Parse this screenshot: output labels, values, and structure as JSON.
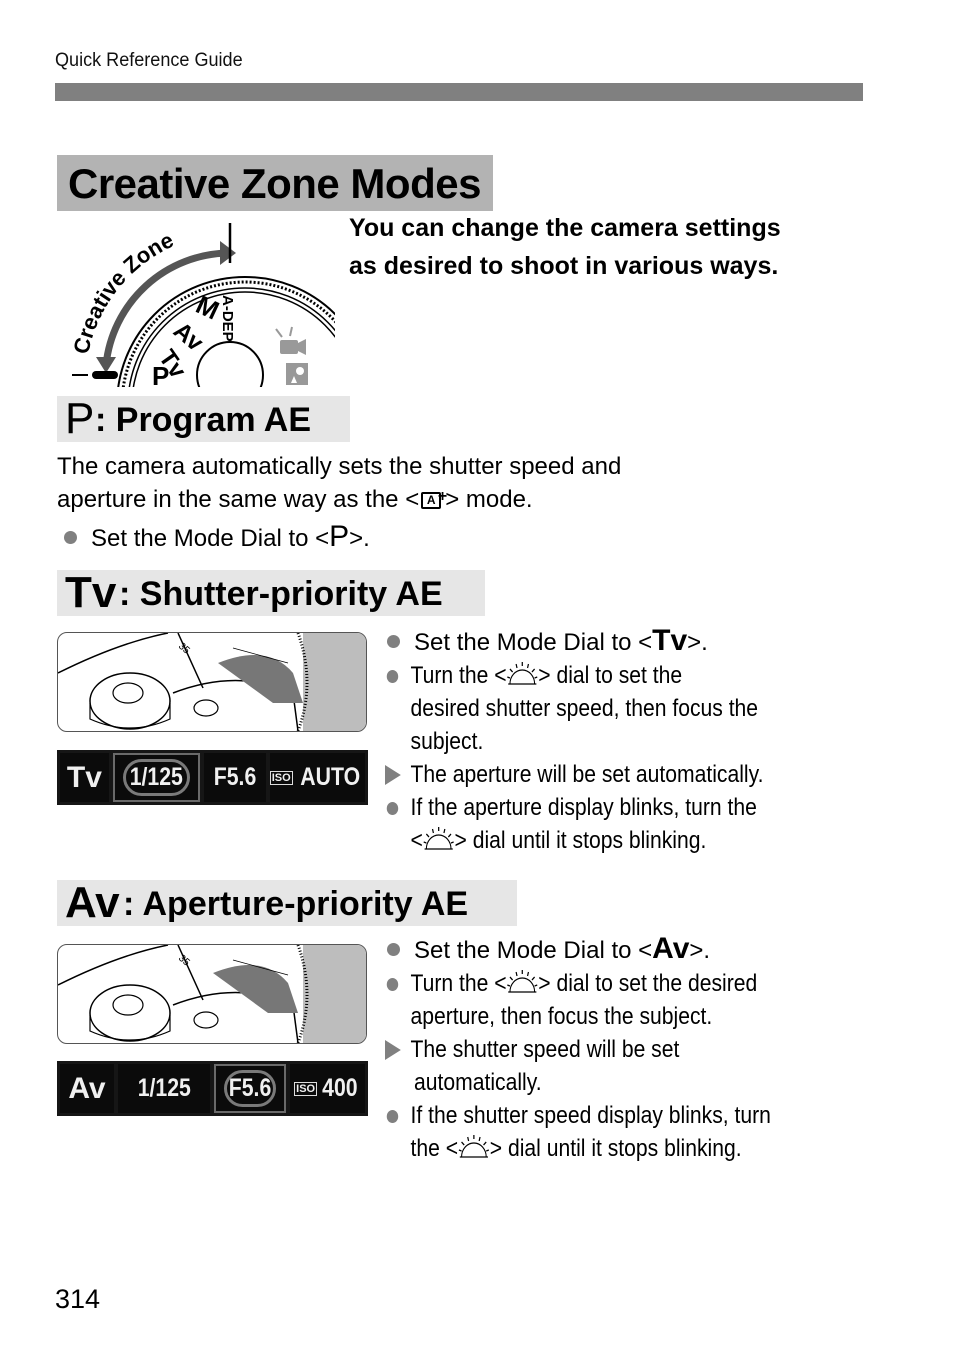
{
  "running_head": "Quick Reference Guide",
  "title": "Creative Zone Modes",
  "intro": "You can change the camera settings as desired to shoot in various ways.",
  "dial": {
    "arc_label": "Creative Zone",
    "modes": [
      "P",
      "Tv",
      "Av",
      "M",
      "A-DEP"
    ],
    "icons": [
      "movie-mode-icon",
      "creative-auto-icon"
    ]
  },
  "sections": [
    {
      "symbol": "P",
      "heading": ": Program AE",
      "description_line1": "The camera automatically sets the shutter speed and",
      "description_line2_pre": "aperture in the same way as the <",
      "description_icon": "scene-intelligent-auto-icon",
      "description_line2_post": "> mode.",
      "bullets": [
        {
          "type": "dot",
          "pre": "Set the Mode Dial to <",
          "sym": "P",
          "post": ">."
        }
      ]
    },
    {
      "symbol": "Tv",
      "heading": ": Shutter-priority AE",
      "bullets": [
        {
          "type": "dot",
          "pre": "Set the Mode Dial to <",
          "sym": "Tv",
          "post": ">."
        },
        {
          "type": "dot",
          "pre": "Turn the <",
          "icon": "main-dial-icon",
          "post": "> dial to set the",
          "cont": [
            "desired shutter speed, then focus the",
            "subject."
          ]
        },
        {
          "type": "triangle",
          "text": "The aperture will be set automatically."
        },
        {
          "type": "dot",
          "text": "If the aperture display blinks, turn the",
          "cont_pre": "<",
          "cont_icon": "main-dial-icon",
          "cont_post": "> dial until it stops blinking."
        }
      ],
      "lcd": {
        "mode": "Tv",
        "shutter": "1/125",
        "aperture": "F5.6",
        "iso_label": "ISO",
        "iso": "AUTO",
        "selected": "shutter"
      }
    },
    {
      "symbol": "Av",
      "heading": ": Aperture-priority AE",
      "bullets": [
        {
          "type": "dot",
          "pre": "Set the Mode Dial to <",
          "sym": "Av",
          "post": ">."
        },
        {
          "type": "dot",
          "pre": "Turn the <",
          "icon": "main-dial-icon",
          "post": "> dial to set the desired",
          "cont": [
            "aperture, then focus the subject."
          ]
        },
        {
          "type": "triangle",
          "text": "The shutter speed will be set",
          "cont": [
            "automatically."
          ]
        },
        {
          "type": "dot",
          "text": "If the shutter speed display blinks, turn",
          "cont_pre": "the <",
          "cont_icon": "main-dial-icon",
          "cont_post": "> dial until it stops blinking."
        }
      ],
      "lcd": {
        "mode": "Av",
        "shutter": "1/125",
        "aperture": "F5.6",
        "iso_label": "ISO",
        "iso": "400",
        "selected": "aperture"
      }
    }
  ],
  "page_number": "314",
  "colors": {
    "header_bar": "#808080",
    "title_box": "#b3b3b3",
    "section_box": "#e6e6e6",
    "bullet": "#808080",
    "lcd_bg": "#161616"
  }
}
